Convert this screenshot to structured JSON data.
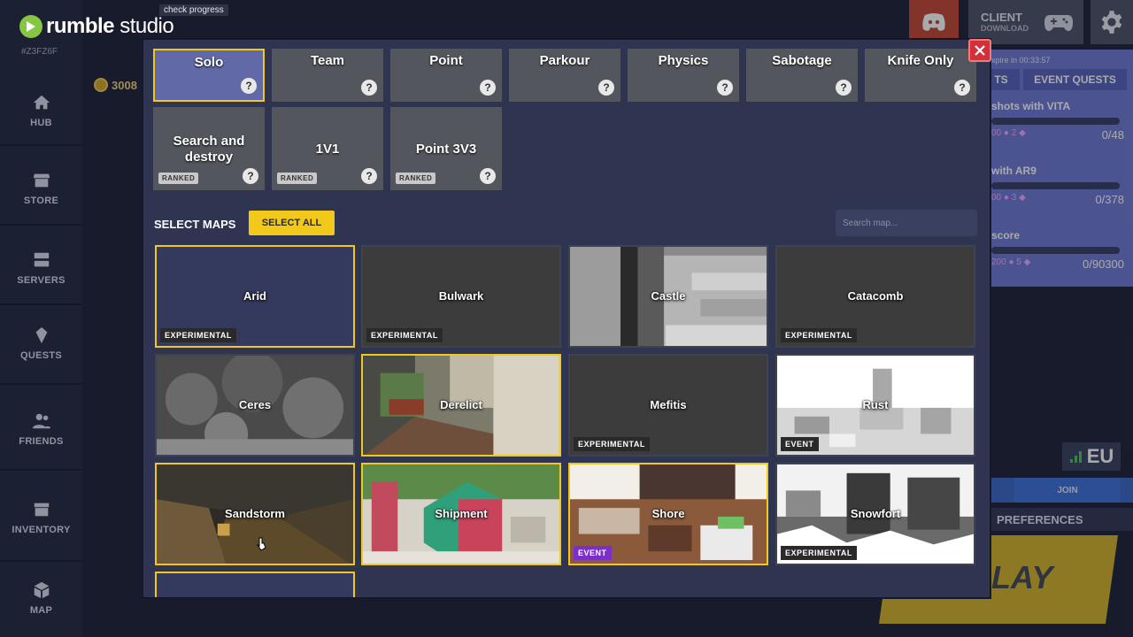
{
  "app": {
    "logo_brand": "rumble",
    "logo_suffix": "studio",
    "user_id": "#Z3FZ6F",
    "check_progress": "check progress",
    "coins": "3008"
  },
  "sidebar": {
    "items": [
      {
        "label": "HUB",
        "icon": "home-icon"
      },
      {
        "label": "STORE",
        "icon": "store-icon"
      },
      {
        "label": "SERVERS",
        "icon": "servers-icon"
      },
      {
        "label": "QUESTS",
        "icon": "quests-icon"
      },
      {
        "label": "FRIENDS",
        "icon": "friends-icon"
      },
      {
        "label": "INVENTORY",
        "icon": "inventory-icon"
      },
      {
        "label": "MAP",
        "icon": "map-icon"
      }
    ]
  },
  "topright": {
    "client_title": "CLIENT",
    "client_sub": "DOWNLOAD"
  },
  "quests_panel": {
    "expire": "xpire in 00:33:57",
    "tab_left": "TS",
    "tab_right": "EVENT QUESTS",
    "quests": [
      {
        "name": "shots with VITA",
        "reward_a": "00",
        "reward_b": "2",
        "progress": "0/48"
      },
      {
        "name": "with AR9",
        "reward_a": "00",
        "reward_b": "3",
        "progress": "0/378"
      },
      {
        "name": "score",
        "reward_a": "200",
        "reward_b": "5",
        "progress": "0/90300"
      }
    ]
  },
  "region": "EU",
  "join_label": "JOIN",
  "preferences_label": "PREFERENCES",
  "play_label": "LAY",
  "modal": {
    "modes": [
      {
        "name": "Solo",
        "selected": true,
        "ranked": false
      },
      {
        "name": "Team",
        "selected": false,
        "ranked": false
      },
      {
        "name": "Point",
        "selected": false,
        "ranked": false
      },
      {
        "name": "Parkour",
        "selected": false,
        "ranked": false
      },
      {
        "name": "Physics",
        "selected": false,
        "ranked": false
      },
      {
        "name": "Sabotage",
        "selected": false,
        "ranked": false
      },
      {
        "name": "Knife Only",
        "selected": false,
        "ranked": false
      },
      {
        "name": "Search and destroy",
        "selected": false,
        "ranked": true
      },
      {
        "name": "1V1",
        "selected": false,
        "ranked": true
      },
      {
        "name": "Point 3V3",
        "selected": false,
        "ranked": true
      }
    ],
    "help_glyph": "?",
    "ranked_label": "RANKED",
    "select_maps_label": "SELECT MAPS",
    "select_all_label": "SELECT ALL",
    "search_placeholder": "Search map...",
    "maps": [
      {
        "name": "Arid",
        "badge": "EXPERIMENTAL",
        "selected": true
      },
      {
        "name": "Bulwark",
        "badge": "EXPERIMENTAL",
        "selected": false
      },
      {
        "name": "Castle",
        "badge": "",
        "selected": false
      },
      {
        "name": "Catacomb",
        "badge": "EXPERIMENTAL",
        "selected": false
      },
      {
        "name": "Ceres",
        "badge": "",
        "selected": false
      },
      {
        "name": "Derelict",
        "badge": "",
        "selected": true
      },
      {
        "name": "Mefitis",
        "badge": "EXPERIMENTAL",
        "selected": false
      },
      {
        "name": "Rust",
        "badge": "EVENT",
        "selected": false
      },
      {
        "name": "Sandstorm",
        "badge": "",
        "selected": true
      },
      {
        "name": "Shipment",
        "badge": "",
        "selected": true
      },
      {
        "name": "Shore",
        "badge": "EVENT",
        "selected": true
      },
      {
        "name": "Snowfort",
        "badge": "EXPERIMENTAL",
        "selected": false
      }
    ]
  },
  "colors": {
    "accent_yellow": "#f2c91a",
    "event_purple": "#7b2fc8",
    "close_red": "#d2313a",
    "quest_panel": "#6f7bd3"
  }
}
